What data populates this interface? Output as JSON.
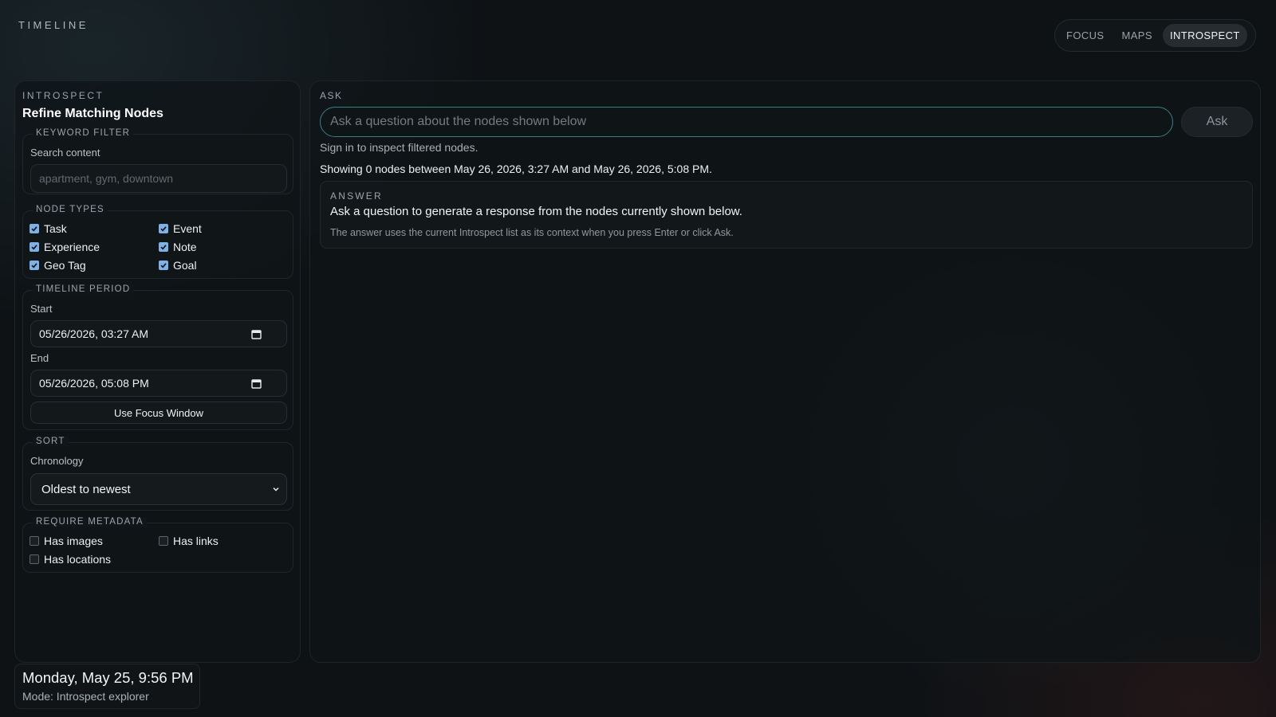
{
  "app": {
    "title": "TIMELINE"
  },
  "nav": {
    "tabs": [
      {
        "label": "FOCUS",
        "active": false
      },
      {
        "label": "MAPS",
        "active": false
      },
      {
        "label": "INTROSPECT",
        "active": true
      }
    ]
  },
  "sidebar": {
    "eyebrow": "INTROSPECT",
    "title": "Refine Matching Nodes",
    "keyword_filter": {
      "legend": "KEYWORD FILTER",
      "label": "Search content",
      "placeholder": "apartment, gym, downtown",
      "value": ""
    },
    "node_types": {
      "legend": "NODE TYPES",
      "items": [
        {
          "label": "Task",
          "checked": true
        },
        {
          "label": "Event",
          "checked": true
        },
        {
          "label": "Experience",
          "checked": true
        },
        {
          "label": "Note",
          "checked": true
        },
        {
          "label": "Geo Tag",
          "checked": true
        },
        {
          "label": "Goal",
          "checked": true
        }
      ]
    },
    "timeline_period": {
      "legend": "TIMELINE PERIOD",
      "start_label": "Start",
      "start_value": "05/26/2026, 03:27 AM",
      "end_label": "End",
      "end_value": "05/26/2026, 05:08 PM",
      "focus_button": "Use Focus Window"
    },
    "sort": {
      "legend": "SORT",
      "label": "Chronology",
      "value": "Oldest to newest"
    },
    "metadata": {
      "legend": "REQUIRE METADATA",
      "items": [
        {
          "label": "Has images",
          "checked": false
        },
        {
          "label": "Has links",
          "checked": false
        },
        {
          "label": "Has locations",
          "checked": false
        }
      ]
    }
  },
  "ask": {
    "label": "ASK",
    "placeholder": "Ask a question about the nodes shown below",
    "value": "",
    "button": "Ask",
    "signin_notice": "Sign in to inspect filtered nodes.",
    "showing": "Showing 0 nodes between May 26, 2026, 3:27 AM and May 26, 2026, 5:08 PM."
  },
  "answer": {
    "eyebrow": "ANSWER",
    "text": "Ask a question to generate a response from the nodes currently shown below.",
    "note": "The answer uses the current Introspect list as its context when you press Enter or click Ask."
  },
  "status": {
    "datetime": "Monday, May 25, 9:56 PM",
    "mode": "Mode: Introspect explorer"
  },
  "colors": {
    "background": "#0e1215",
    "accent_focus_ring": "#3e7d84",
    "checkbox_checked": "#7fb0e6",
    "active_tab": "#262c30"
  },
  "icons": {
    "calendar": "calendar-icon",
    "chevron": "chevron-down-icon",
    "check": "check-icon"
  }
}
